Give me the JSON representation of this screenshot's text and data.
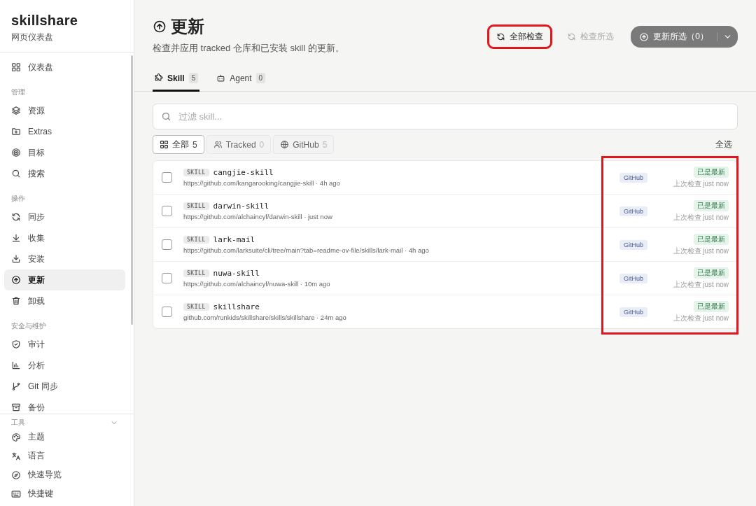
{
  "sidebar": {
    "brand": "skillshare",
    "subtitle": "网页仪表盘",
    "sections": [
      {
        "items": [
          {
            "label": "仪表盘",
            "selected": false
          }
        ]
      },
      {
        "label": "管理",
        "items": [
          {
            "label": "资源",
            "selected": false
          },
          {
            "label": "Extras",
            "selected": false
          },
          {
            "label": "目标",
            "selected": false
          },
          {
            "label": "搜索",
            "selected": false
          }
        ]
      },
      {
        "label": "操作",
        "items": [
          {
            "label": "同步",
            "selected": false
          },
          {
            "label": "收集",
            "selected": false
          },
          {
            "label": "安装",
            "selected": false
          },
          {
            "label": "更新",
            "selected": true
          },
          {
            "label": "卸载",
            "selected": false
          }
        ]
      },
      {
        "label": "安全与维护",
        "items": [
          {
            "label": "审计",
            "selected": false
          },
          {
            "label": "分析",
            "selected": false
          },
          {
            "label": "Git 同步",
            "selected": false
          },
          {
            "label": "备份",
            "selected": false
          }
        ]
      }
    ],
    "tools": {
      "label": "工具",
      "expanded": true,
      "items": [
        {
          "label": "主题",
          "selected": false
        },
        {
          "label": "语言",
          "selected": false
        },
        {
          "label": "快速导览",
          "selected": false
        },
        {
          "label": "快捷键",
          "selected": false
        }
      ]
    }
  },
  "header": {
    "title": "更新",
    "subtitle": "检查并应用 tracked 仓库和已安装 skill 的更新。",
    "buttons": [
      {
        "label": "全部检查",
        "kind": "outline",
        "disabled": false,
        "highlighted": true
      },
      {
        "label": "检查所选",
        "kind": "ghost",
        "disabled": true,
        "highlighted": false
      },
      {
        "label": "更新所选（0）",
        "kind": "primary",
        "disabled": true,
        "highlighted": false
      }
    ]
  },
  "tabs": [
    {
      "label": "Skill",
      "count": "5",
      "selected": true
    },
    {
      "label": "Agent",
      "count": "0",
      "selected": false
    }
  ],
  "search": {
    "placeholder": "过滤 skill..."
  },
  "filters": [
    {
      "label": "全部",
      "count": "5",
      "selected": true
    },
    {
      "label": "Tracked",
      "count": "0",
      "selected": false
    },
    {
      "label": "GitHub",
      "count": "5",
      "selected": false
    }
  ],
  "select_all": "全选",
  "status_column_highlighted": true,
  "rows": [
    {
      "tag": "SKILL",
      "name": "cangjie-skill",
      "source": "https://github.com/kangarooking/cangjie-skill · 4h ago",
      "badge": "GitHub",
      "status": "已是最新",
      "checked_at": "上次检查 just now",
      "checked": false
    },
    {
      "tag": "SKILL",
      "name": "darwin-skill",
      "source": "https://github.com/alchaincyf/darwin-skill · just now",
      "badge": "GitHub",
      "status": "已是最新",
      "checked_at": "上次检查 just now",
      "checked": false
    },
    {
      "tag": "SKILL",
      "name": "lark-mail",
      "source": "https://github.com/larksuite/cli/tree/main?tab=readme-ov-file/skills/lark-mail · 4h ago",
      "badge": "GitHub",
      "status": "已是最新",
      "checked_at": "上次检查 just now",
      "checked": false
    },
    {
      "tag": "SKILL",
      "name": "nuwa-skill",
      "source": "https://github.com/alchaincyf/nuwa-skill · 10m ago",
      "badge": "GitHub",
      "status": "已是最新",
      "checked_at": "上次检查 just now",
      "checked": false
    },
    {
      "tag": "SKILL",
      "name": "skillshare",
      "source": "github.com/runkids/skillshare/skills/skillshare · 24m ago",
      "badge": "GitHub",
      "status": "已是最新",
      "checked_at": "上次检查 just now",
      "checked": false
    }
  ]
}
